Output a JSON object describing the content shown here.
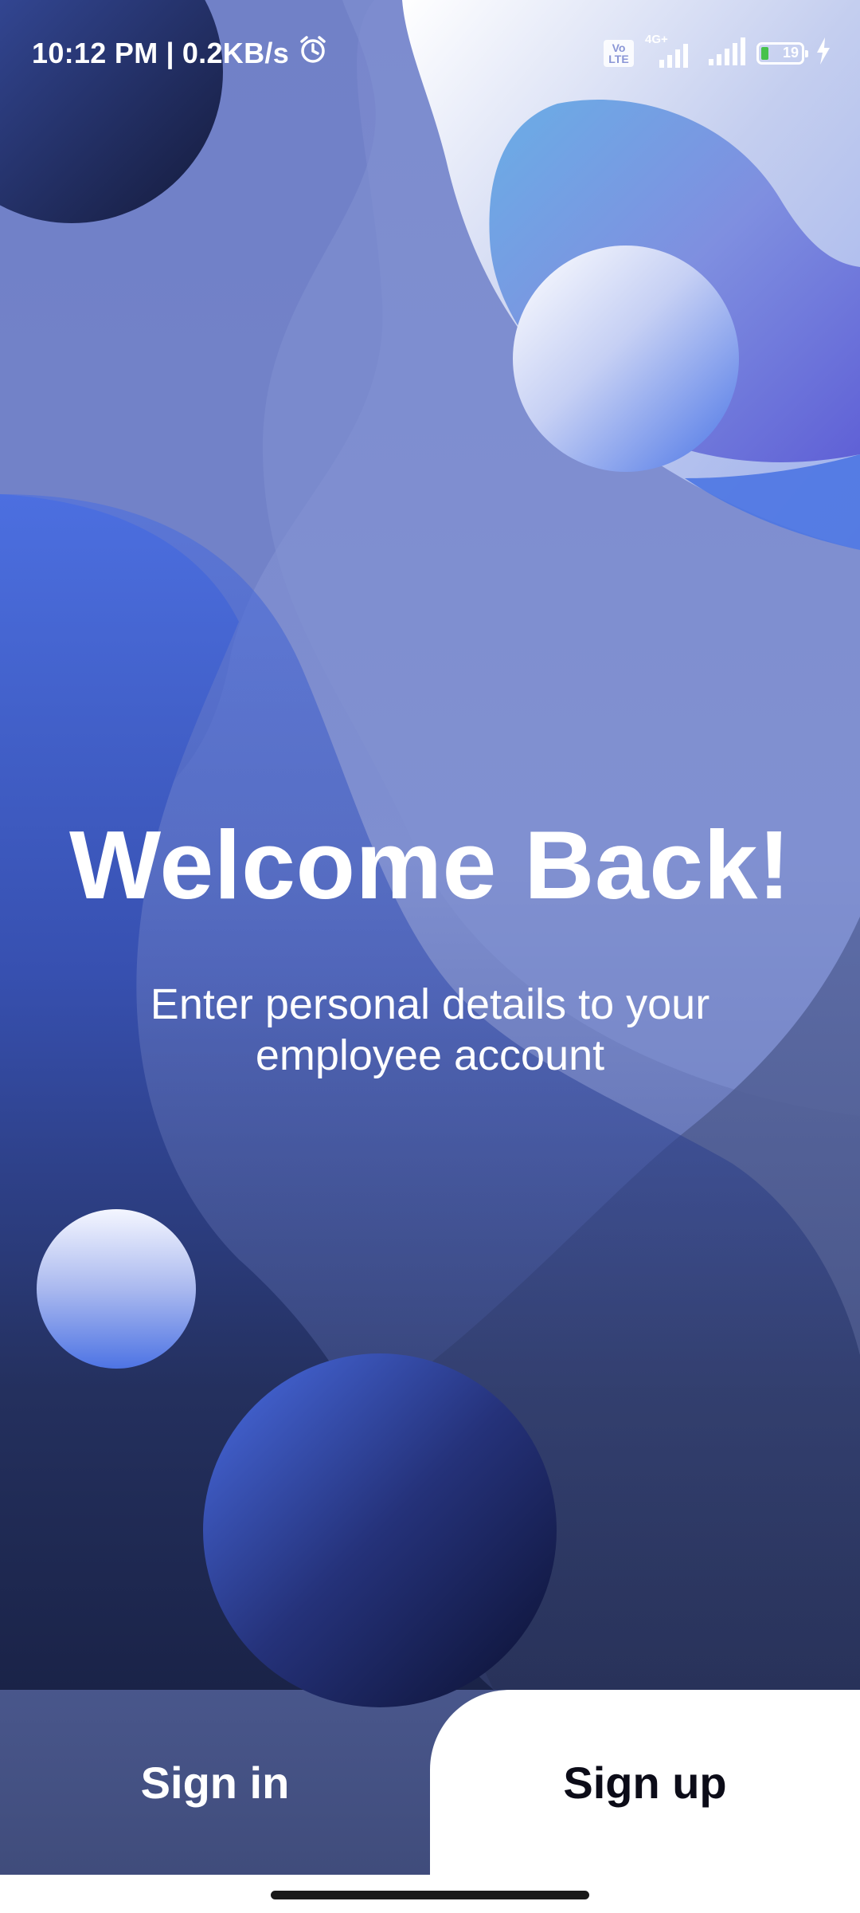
{
  "status_bar": {
    "time": "10:12 PM",
    "separator": "|",
    "net_speed": "0.2KB/s",
    "alarm_icon": "alarm-clock-icon",
    "volte_label": "Vo LTE",
    "network_type": "4G+",
    "battery_level": "19",
    "charging_icon": "lightning-bolt-icon"
  },
  "hero": {
    "title": "Welcome Back!",
    "subtitle": "Enter personal details to your employee account"
  },
  "tabs": {
    "signin_label": "Sign in",
    "signup_label": "Sign up"
  },
  "colors": {
    "background_mid": "#7c8bd0",
    "blob_blue": "#4a6de0",
    "blob_navy": "#1c2550",
    "signup_bg": "#ffffff",
    "signup_text": "#0c0c18",
    "battery_fill": "#46c24b"
  }
}
